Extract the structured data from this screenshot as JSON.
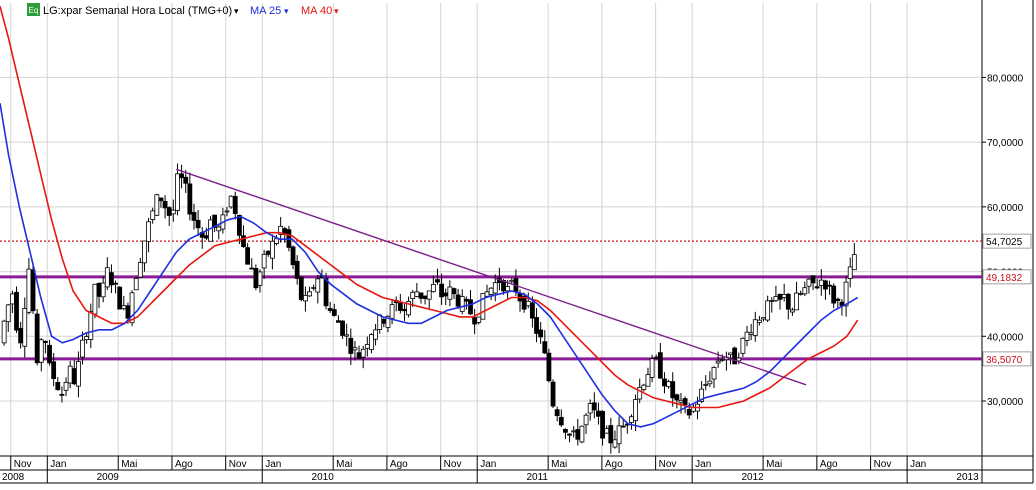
{
  "header": {
    "icon_label": "Eq",
    "instrument": "LG:xpar Semanal Hora Local (TMG+0)",
    "indicator_ma25": "MA 25",
    "indicator_ma40": "MA 40",
    "dropdown_glyph": "▾"
  },
  "colors": {
    "background": "#ffffff",
    "grid": "#d4d4d4",
    "candle_up_fill": "#ffffff",
    "candle_down_fill": "#000000",
    "ma25": "#1f2fe0",
    "ma40": "#e8170f",
    "trendline": "#7a1f8a",
    "support_line": "#8a1a96",
    "last_price_line": "#c8141e",
    "last_price_label": "#000000",
    "level_label": "#c8141e"
  },
  "chart_data": {
    "type": "candlestick",
    "title": "LG:xpar Semanal Hora Local (TMG+0)",
    "timeframe": "weekly",
    "ylim": [
      21.5,
      91.5
    ],
    "y_ticks": [
      30,
      40,
      50,
      60,
      70,
      80
    ],
    "y_tick_labels": [
      "30,0000",
      "40,0000",
      "50,0000",
      "60,0000",
      "70,0000",
      "80,0000"
    ],
    "x_month_ticks": [
      {
        "label": "Nov",
        "t": 2008.83
      },
      {
        "label": "Jan",
        "t": 2009.0
      },
      {
        "label": "Mai",
        "t": 2009.33
      },
      {
        "label": "Ago",
        "t": 2009.58
      },
      {
        "label": "Nov",
        "t": 2009.83
      },
      {
        "label": "Jan",
        "t": 2010.0
      },
      {
        "label": "Mai",
        "t": 2010.33
      },
      {
        "label": "Ago",
        "t": 2010.58
      },
      {
        "label": "Nov",
        "t": 2010.83
      },
      {
        "label": "Jan",
        "t": 2011.0
      },
      {
        "label": "Mai",
        "t": 2011.33
      },
      {
        "label": "Ago",
        "t": 2011.58
      },
      {
        "label": "Nov",
        "t": 2011.83
      },
      {
        "label": "Jan",
        "t": 2012.0
      },
      {
        "label": "Mai",
        "t": 2012.33
      },
      {
        "label": "Ago",
        "t": 2012.58
      },
      {
        "label": "Nov",
        "t": 2012.83
      },
      {
        "label": "Jan",
        "t": 2013.0
      }
    ],
    "x_year_labels": [
      {
        "label": "2008",
        "t": 2008.78
      },
      {
        "label": "2009",
        "t": 2009.22
      },
      {
        "label": "2010",
        "t": 2010.22
      },
      {
        "label": "2011",
        "t": 2011.22
      },
      {
        "label": "2012",
        "t": 2012.22
      },
      {
        "label": "2013",
        "t": 2013.22
      }
    ],
    "x_year_separators": [
      2009.0,
      2010.0,
      2011.0,
      2012.0,
      2013.0
    ],
    "x_range": [
      2008.78,
      2013.46
    ],
    "price_anchors": [
      [
        2008.78,
        39
      ],
      [
        2008.81,
        44
      ],
      [
        2008.84,
        47
      ],
      [
        2008.87,
        38
      ],
      [
        2008.89,
        44
      ],
      [
        2008.92,
        52
      ],
      [
        2008.95,
        34
      ],
      [
        2008.98,
        42
      ],
      [
        2009.01,
        35
      ],
      [
        2009.04,
        33
      ],
      [
        2009.07,
        31
      ],
      [
        2009.1,
        35
      ],
      [
        2009.13,
        33
      ],
      [
        2009.16,
        38
      ],
      [
        2009.19,
        42
      ],
      [
        2009.22,
        47
      ],
      [
        2009.25,
        46
      ],
      [
        2009.28,
        50
      ],
      [
        2009.31,
        48
      ],
      [
        2009.34,
        45
      ],
      [
        2009.37,
        43
      ],
      [
        2009.4,
        48
      ],
      [
        2009.43,
        52
      ],
      [
        2009.46,
        56
      ],
      [
        2009.49,
        59
      ],
      [
        2009.52,
        62
      ],
      [
        2009.55,
        60
      ],
      [
        2009.58,
        58
      ],
      [
        2009.61,
        65
      ],
      [
        2009.64,
        63
      ],
      [
        2009.67,
        59
      ],
      [
        2009.7,
        57
      ],
      [
        2009.73,
        55
      ],
      [
        2009.76,
        58
      ],
      [
        2009.79,
        56
      ],
      [
        2009.82,
        58
      ],
      [
        2009.85,
        62
      ],
      [
        2009.88,
        59
      ],
      [
        2009.91,
        54
      ],
      [
        2009.94,
        51
      ],
      [
        2009.97,
        48
      ],
      [
        2010.0,
        51
      ],
      [
        2010.03,
        53
      ],
      [
        2010.06,
        55
      ],
      [
        2010.09,
        57
      ],
      [
        2010.12,
        54
      ],
      [
        2010.15,
        50
      ],
      [
        2010.18,
        46
      ],
      [
        2010.21,
        45
      ],
      [
        2010.24,
        48
      ],
      [
        2010.27,
        50
      ],
      [
        2010.3,
        45
      ],
      [
        2010.33,
        43
      ],
      [
        2010.36,
        42
      ],
      [
        2010.39,
        40
      ],
      [
        2010.42,
        38
      ],
      [
        2010.45,
        37
      ],
      [
        2010.48,
        39
      ],
      [
        2010.51,
        41
      ],
      [
        2010.54,
        42
      ],
      [
        2010.57,
        43
      ],
      [
        2010.6,
        44
      ],
      [
        2010.63,
        45
      ],
      [
        2010.66,
        44
      ],
      [
        2010.69,
        46
      ],
      [
        2010.72,
        47
      ],
      [
        2010.75,
        46
      ],
      [
        2010.78,
        47
      ],
      [
        2010.81,
        48
      ],
      [
        2010.84,
        46
      ],
      [
        2010.87,
        47
      ],
      [
        2010.9,
        46
      ],
      [
        2010.93,
        45
      ],
      [
        2010.96,
        44
      ],
      [
        2010.99,
        43
      ],
      [
        2011.02,
        45
      ],
      [
        2011.05,
        47
      ],
      [
        2011.08,
        48
      ],
      [
        2011.11,
        49
      ],
      [
        2011.14,
        47
      ],
      [
        2011.17,
        48
      ],
      [
        2011.2,
        46
      ],
      [
        2011.23,
        45
      ],
      [
        2011.26,
        42
      ],
      [
        2011.29,
        40
      ],
      [
        2011.32,
        36
      ],
      [
        2011.35,
        30
      ],
      [
        2011.38,
        28
      ],
      [
        2011.41,
        26
      ],
      [
        2011.44,
        24
      ],
      [
        2011.47,
        25
      ],
      [
        2011.5,
        27
      ],
      [
        2011.53,
        29
      ],
      [
        2011.56,
        27
      ],
      [
        2011.59,
        25
      ],
      [
        2011.62,
        24
      ],
      [
        2011.65,
        25
      ],
      [
        2011.68,
        26
      ],
      [
        2011.71,
        28
      ],
      [
        2011.74,
        31
      ],
      [
        2011.77,
        33
      ],
      [
        2011.8,
        35
      ],
      [
        2011.83,
        36
      ],
      [
        2011.86,
        34
      ],
      [
        2011.89,
        32
      ],
      [
        2011.92,
        30
      ],
      [
        2011.95,
        29
      ],
      [
        2011.98,
        28
      ],
      [
        2012.01,
        29
      ],
      [
        2012.04,
        31
      ],
      [
        2012.07,
        33
      ],
      [
        2012.1,
        35
      ],
      [
        2012.13,
        37
      ],
      [
        2012.16,
        37
      ],
      [
        2012.19,
        36
      ],
      [
        2012.22,
        38
      ],
      [
        2012.25,
        40
      ],
      [
        2012.28,
        42
      ],
      [
        2012.31,
        43
      ],
      [
        2012.34,
        44
      ],
      [
        2012.37,
        45
      ],
      [
        2012.4,
        45
      ],
      [
        2012.43,
        46
      ],
      [
        2012.46,
        44
      ],
      [
        2012.49,
        46
      ],
      [
        2012.52,
        47
      ],
      [
        2012.55,
        48
      ],
      [
        2012.58,
        48
      ],
      [
        2012.61,
        49
      ],
      [
        2012.64,
        47
      ],
      [
        2012.67,
        45
      ],
      [
        2012.7,
        46
      ],
      [
        2012.73,
        49
      ],
      [
        2012.75,
        52
      ],
      [
        2012.77,
        54.7
      ]
    ],
    "candle_period_years": 0.0192,
    "candle_seed": 7,
    "ma25_curve": [
      [
        2008.78,
        76
      ],
      [
        2008.82,
        68
      ],
      [
        2008.87,
        60
      ],
      [
        2008.92,
        53
      ],
      [
        2008.97,
        46
      ],
      [
        2009.02,
        40
      ],
      [
        2009.07,
        39
      ],
      [
        2009.12,
        39.5
      ],
      [
        2009.18,
        40.5
      ],
      [
        2009.24,
        41
      ],
      [
        2009.3,
        41
      ],
      [
        2009.36,
        42
      ],
      [
        2009.42,
        44
      ],
      [
        2009.48,
        47
      ],
      [
        2009.54,
        50
      ],
      [
        2009.6,
        53
      ],
      [
        2009.66,
        55
      ],
      [
        2009.72,
        56
      ],
      [
        2009.78,
        57
      ],
      [
        2009.84,
        58
      ],
      [
        2009.9,
        58.5
      ],
      [
        2009.96,
        57.5
      ],
      [
        2010.02,
        56
      ],
      [
        2010.08,
        55
      ],
      [
        2010.14,
        55
      ],
      [
        2010.2,
        53
      ],
      [
        2010.26,
        50
      ],
      [
        2010.32,
        48
      ],
      [
        2010.38,
        46.5
      ],
      [
        2010.44,
        45
      ],
      [
        2010.5,
        44
      ],
      [
        2010.56,
        43
      ],
      [
        2010.62,
        42.5
      ],
      [
        2010.68,
        42
      ],
      [
        2010.74,
        42
      ],
      [
        2010.8,
        43
      ],
      [
        2010.86,
        44
      ],
      [
        2010.92,
        44.5
      ],
      [
        2010.98,
        45
      ],
      [
        2011.04,
        46
      ],
      [
        2011.1,
        46.5
      ],
      [
        2011.16,
        47
      ],
      [
        2011.22,
        46.5
      ],
      [
        2011.28,
        45
      ],
      [
        2011.34,
        43
      ],
      [
        2011.4,
        40
      ],
      [
        2011.46,
        37
      ],
      [
        2011.52,
        34
      ],
      [
        2011.58,
        31
      ],
      [
        2011.64,
        28.5
      ],
      [
        2011.7,
        26.5
      ],
      [
        2011.76,
        26
      ],
      [
        2011.82,
        26.5
      ],
      [
        2011.88,
        27.5
      ],
      [
        2011.94,
        28.5
      ],
      [
        2012.0,
        29.5
      ],
      [
        2012.06,
        30.5
      ],
      [
        2012.12,
        31
      ],
      [
        2012.18,
        31.5
      ],
      [
        2012.24,
        32
      ],
      [
        2012.3,
        33
      ],
      [
        2012.36,
        34.5
      ],
      [
        2012.42,
        36.5
      ],
      [
        2012.48,
        38.5
      ],
      [
        2012.54,
        40.5
      ],
      [
        2012.6,
        42.5
      ],
      [
        2012.66,
        44
      ],
      [
        2012.72,
        45
      ],
      [
        2012.77,
        46
      ]
    ],
    "ma40_curve": [
      [
        2008.78,
        91
      ],
      [
        2008.82,
        86
      ],
      [
        2008.87,
        79
      ],
      [
        2008.92,
        72
      ],
      [
        2008.97,
        65
      ],
      [
        2009.02,
        58
      ],
      [
        2009.07,
        52
      ],
      [
        2009.12,
        47
      ],
      [
        2009.18,
        44
      ],
      [
        2009.24,
        43
      ],
      [
        2009.3,
        42
      ],
      [
        2009.36,
        42
      ],
      [
        2009.42,
        43
      ],
      [
        2009.48,
        45
      ],
      [
        2009.54,
        47
      ],
      [
        2009.6,
        49
      ],
      [
        2009.66,
        51
      ],
      [
        2009.72,
        52.5
      ],
      [
        2009.78,
        54
      ],
      [
        2009.84,
        54.5
      ],
      [
        2009.9,
        55
      ],
      [
        2009.96,
        55.5
      ],
      [
        2010.02,
        56
      ],
      [
        2010.08,
        56
      ],
      [
        2010.14,
        55.5
      ],
      [
        2010.2,
        54
      ],
      [
        2010.26,
        52.5
      ],
      [
        2010.32,
        51
      ],
      [
        2010.38,
        49.5
      ],
      [
        2010.44,
        48
      ],
      [
        2010.5,
        47
      ],
      [
        2010.56,
        46
      ],
      [
        2010.62,
        45.5
      ],
      [
        2010.68,
        45
      ],
      [
        2010.74,
        44.5
      ],
      [
        2010.8,
        44
      ],
      [
        2010.86,
        43.5
      ],
      [
        2010.92,
        43
      ],
      [
        2010.98,
        43
      ],
      [
        2011.04,
        44
      ],
      [
        2011.1,
        45
      ],
      [
        2011.16,
        46
      ],
      [
        2011.22,
        46
      ],
      [
        2011.28,
        45.5
      ],
      [
        2011.34,
        44
      ],
      [
        2011.4,
        42
      ],
      [
        2011.46,
        40
      ],
      [
        2011.52,
        38
      ],
      [
        2011.58,
        36
      ],
      [
        2011.64,
        34
      ],
      [
        2011.7,
        32.5
      ],
      [
        2011.76,
        31.5
      ],
      [
        2011.82,
        30.5
      ],
      [
        2011.88,
        30
      ],
      [
        2011.94,
        29.5
      ],
      [
        2012.0,
        29
      ],
      [
        2012.06,
        29
      ],
      [
        2012.12,
        29
      ],
      [
        2012.18,
        29.5
      ],
      [
        2012.24,
        30
      ],
      [
        2012.3,
        31
      ],
      [
        2012.36,
        32
      ],
      [
        2012.42,
        33.5
      ],
      [
        2012.48,
        35
      ],
      [
        2012.54,
        36.5
      ],
      [
        2012.6,
        37.5
      ],
      [
        2012.66,
        38.5
      ],
      [
        2012.72,
        40
      ],
      [
        2012.77,
        42.5
      ]
    ],
    "trendline": {
      "from": [
        2009.6,
        65.8
      ],
      "to": [
        2012.53,
        32.5
      ]
    },
    "support_lines": [
      49.1832,
      36.507
    ],
    "last_price": 54.7025,
    "level_labels": [
      {
        "value": 54.7025,
        "text": "54,7025",
        "style": "last"
      },
      {
        "value": 49.1832,
        "text": "49,1832",
        "style": "level"
      },
      {
        "value": 36.507,
        "text": "36,5070",
        "style": "level"
      }
    ],
    "grid": true,
    "legend": "top-left"
  }
}
